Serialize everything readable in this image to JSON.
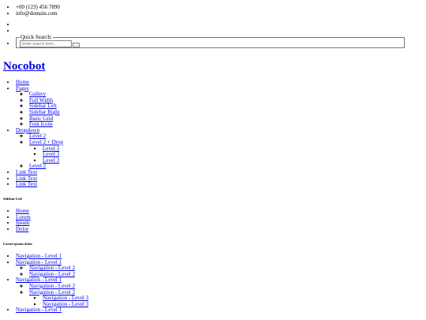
{
  "contact": {
    "phone": "+00 (123) 456 7890",
    "email": "info@domain.com"
  },
  "search": {
    "legend": "Quick Search:",
    "placeholder": "Enter search term..."
  },
  "site": {
    "title": "Nocobot"
  },
  "nav": {
    "home": "Home",
    "pages": "Pages",
    "pages_items": [
      "Gallery",
      "Full Width",
      "Sidebar Left",
      "Sidebar Right",
      "Basic Grid",
      "Font Icons"
    ],
    "dropdown": "Dropdown",
    "level2_a": "Level 2",
    "level2_drop": "Level 2 + Drop",
    "level3_items": [
      "Level 3",
      "Level 3",
      "Level 3"
    ],
    "level2_b": "Level 2",
    "link_texts": [
      "Link Text",
      "Link Text",
      "Link Text"
    ]
  },
  "sidebar": {
    "heading": "Sidebar Left",
    "items": [
      "Home",
      "Lorem",
      "Ipsum",
      "Dolor"
    ]
  },
  "subnav": {
    "heading": "Lorem ipsum dolor",
    "l1": "Navigation - Level 1",
    "l2": "Navigation - Level 2",
    "l3": "Navigation - Level 3"
  }
}
